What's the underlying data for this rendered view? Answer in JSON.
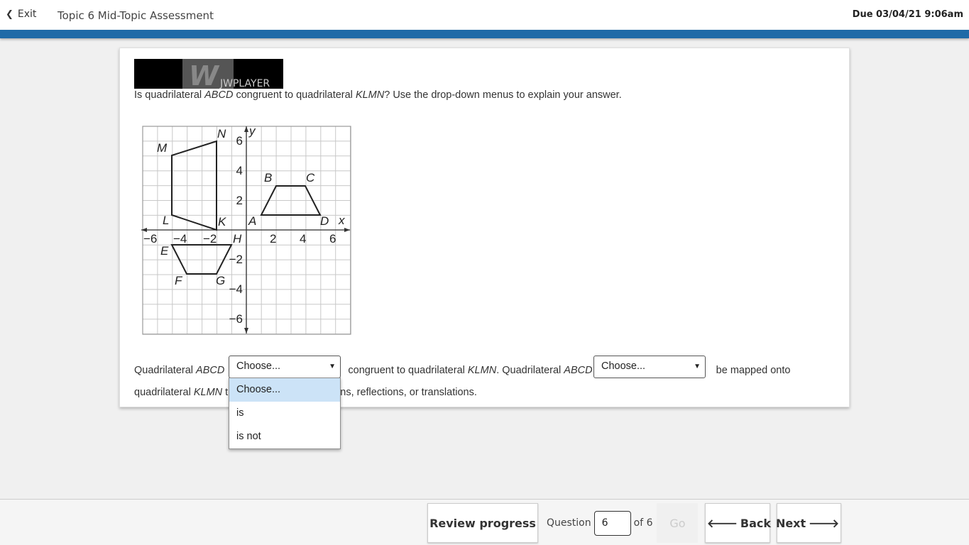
{
  "header": {
    "exit_label": "Exit",
    "title": "Topic 6 Mid-Topic Assessment",
    "due": "Due 03/04/21 9:06am"
  },
  "player": {
    "logo_text": "JWPLAYER",
    "logo_mark": "W"
  },
  "question": {
    "pre": "Is quadrilateral ",
    "shape1": "ABCD",
    "mid": " congruent to quadrilateral ",
    "shape2": "KLMN",
    "post": "? Use the drop-down menus to explain your answer."
  },
  "graph": {
    "x_ticks": [
      "−6",
      "−4",
      "−2",
      "2",
      "4",
      "6"
    ],
    "y_ticks": [
      "6",
      "4",
      "2",
      "−2",
      "−4",
      "−6"
    ],
    "x_axis_label": "x",
    "y_axis_label": "y",
    "origin_label": "H",
    "vertex_labels": [
      "M",
      "N",
      "L",
      "K",
      "A",
      "B",
      "C",
      "D",
      "E",
      "F",
      "G"
    ]
  },
  "answer": {
    "t1": "Quadrilateral ",
    "s1": "ABCD",
    "t2": " congruent to quadrilateral ",
    "s2": "KLMN",
    "t3": ". Quadrilateral ",
    "s3": "ABCD",
    "t4": " be mapped onto",
    "t5": "quadrilateral ",
    "s5": "KLMN",
    "t6": " t",
    "t7": "ons, reflections, or translations.",
    "select1_value": "Choose...",
    "select2_value": "Choose..."
  },
  "dropdown": {
    "options": [
      "Choose...",
      "is",
      "is not"
    ]
  },
  "footer": {
    "review_label": "Review progress",
    "question_label": "Question",
    "question_value": "6",
    "of_label": "of 6",
    "go_label": "Go",
    "back_label": "Back",
    "next_label": "Next"
  }
}
